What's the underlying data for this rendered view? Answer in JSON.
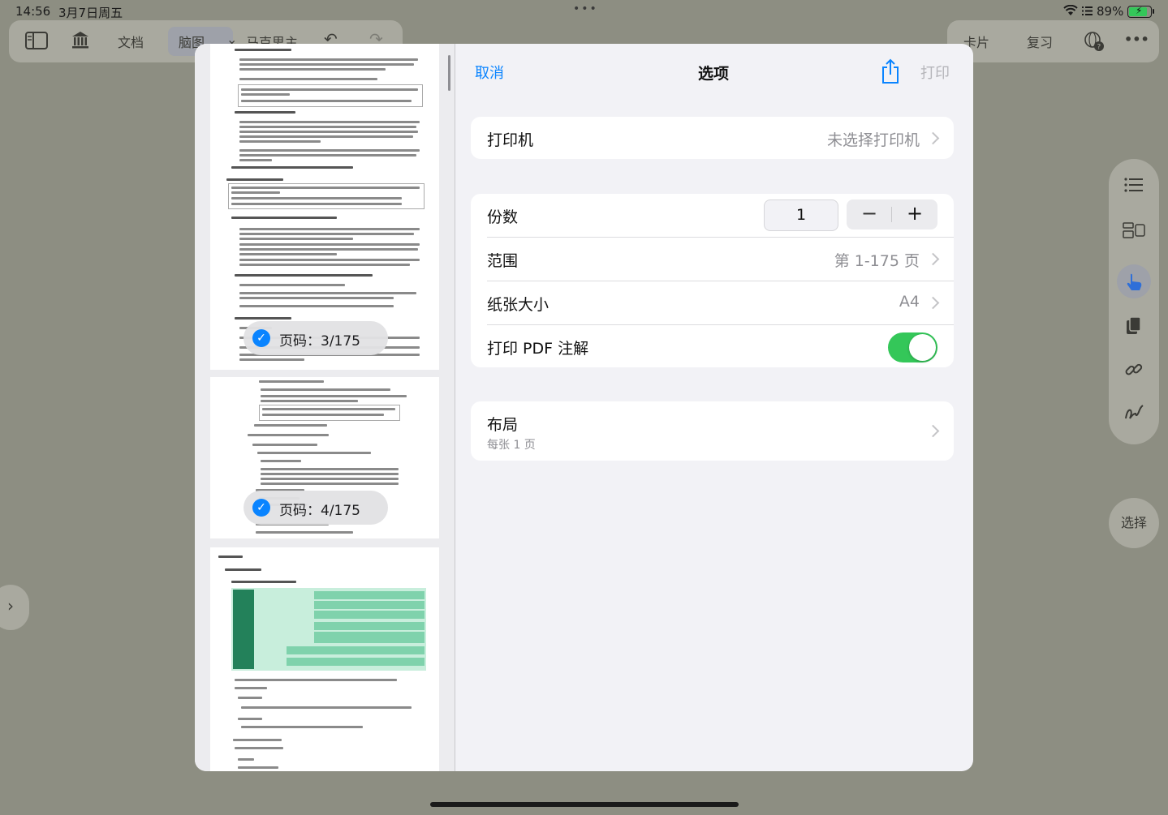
{
  "status_bar": {
    "time": "14:56",
    "date": "3月7日周五",
    "battery_percent": "89%",
    "multitask_dots": "•••"
  },
  "toolbar": {
    "doc_label": "文档",
    "mindmap_label": "脑图",
    "book_title": "马克思主",
    "card_label": "卡片",
    "review_label": "复习",
    "more_label": "•••"
  },
  "side": {
    "select_label": "选择"
  },
  "preview": {
    "badges": [
      "页码：3/175",
      "页码：4/175"
    ]
  },
  "dialog": {
    "cancel": "取消",
    "title": "选项",
    "print": "打印",
    "printer_label": "打印机",
    "printer_value": "未选择打印机",
    "copies_label": "份数",
    "copies_value": "1",
    "range_label": "范围",
    "range_value": "第 1-175 页",
    "paper_label": "纸张大小",
    "paper_value": "A4",
    "annot_label": "打印 PDF 注解",
    "annot_on": true,
    "layout_label": "布局",
    "layout_sub": "每张 1 页"
  },
  "colors": {
    "accent": "#0a84ff",
    "toggle_on": "#34c759",
    "background": "#8d8e82"
  }
}
